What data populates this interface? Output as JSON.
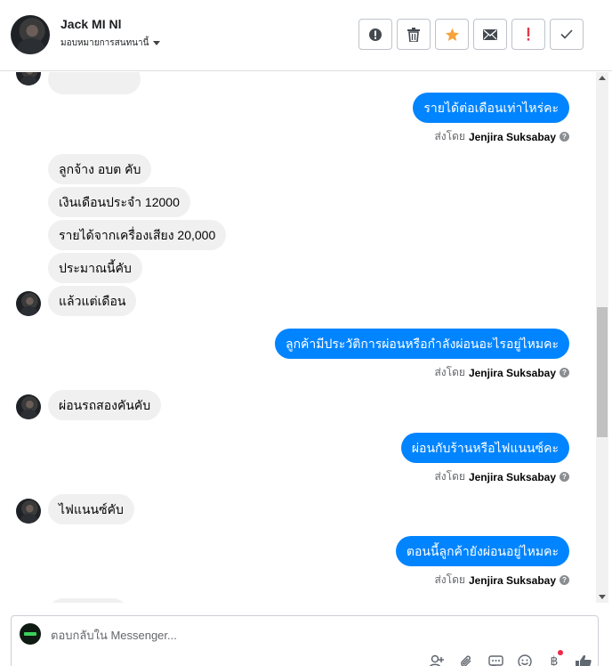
{
  "header": {
    "name": "Jack MI Nl",
    "subtitle": "มอบหมายการสนทนานี้"
  },
  "messages": {
    "m1": "รายได้ต่อเดือนเท่าไหร่คะ",
    "m2": "ลูกจ้าง อบต คับ",
    "m3": "เงินเดือนประจำ 12000",
    "m4": "รายได้จากเครื่องเสียง 20,000",
    "m5": "ประมาณนี้คับ",
    "m6": "แล้วแต่เดือน",
    "m7": "ลูกค้ามีประวัติการผ่อนหรือกำลังผ่อนอะไรอยู่ไหมคะ",
    "m8": "ผ่อนรถสองคันคับ",
    "m9": "ผ่อนกับร้านหรือไฟแนนซ์คะ",
    "m10": "ไฟแนนซ์คับ",
    "m11": "ตอนนี้ลูกค้ายังผ่อนอยู่ไหมคะ"
  },
  "sent_by": {
    "prefix": "ส่งโดย",
    "agent": "Jenjira Suksabay"
  },
  "composer": {
    "placeholder": "ตอบกลับใน Messenger..."
  },
  "icons": {
    "actions": [
      "alert-circle-icon",
      "trash-icon",
      "star-icon",
      "mail-icon",
      "exclamation-icon",
      "check-icon"
    ],
    "tools": [
      "add-person-icon",
      "paperclip-icon",
      "saved-replies-icon",
      "emoji-icon",
      "currency-icon",
      "like-icon"
    ]
  },
  "colors": {
    "outgoing_bubble": "#0084ff",
    "incoming_bubble": "#f0f0f0",
    "star": "#f5a33b",
    "exclamation": "#e4384b"
  }
}
